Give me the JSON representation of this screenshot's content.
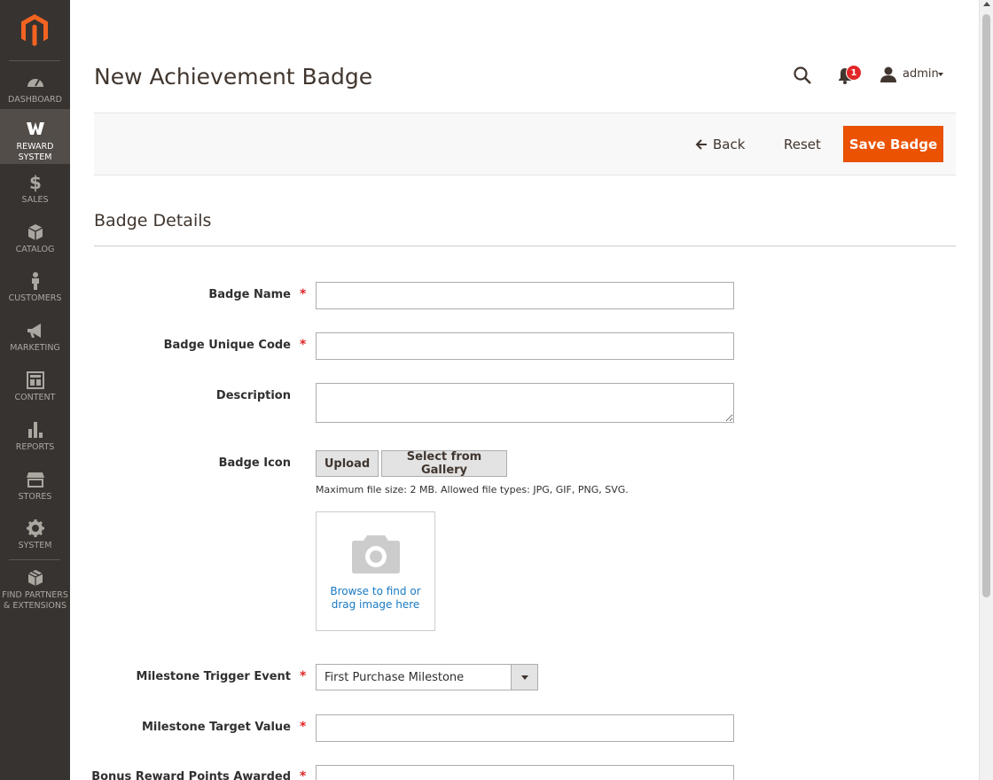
{
  "sidebar": {
    "items": [
      {
        "label": "DASHBOARD",
        "icon": "dashboard-icon"
      },
      {
        "label": "REWARD",
        "label2": "SYSTEM",
        "icon": "reward-w-icon"
      },
      {
        "label": "SALES",
        "icon": "dollar-icon"
      },
      {
        "label": "CATALOG",
        "icon": "box-icon"
      },
      {
        "label": "CUSTOMERS",
        "icon": "person-icon"
      },
      {
        "label": "MARKETING",
        "icon": "megaphone-icon"
      },
      {
        "label": "CONTENT",
        "icon": "content-layout-icon"
      },
      {
        "label": "REPORTS",
        "icon": "bar-chart-icon"
      },
      {
        "label": "STORES",
        "icon": "store-icon"
      },
      {
        "label": "SYSTEM",
        "icon": "gear-icon"
      },
      {
        "label": "FIND PARTNERS",
        "label2": "& EXTENSIONS",
        "icon": "extensions-box-icon"
      }
    ]
  },
  "header": {
    "title": "New Achievement Badge",
    "notification_count": "1",
    "username": "admin"
  },
  "actions": {
    "back": "Back",
    "reset": "Reset",
    "save": "Save Badge"
  },
  "section": {
    "title": "Badge Details"
  },
  "form": {
    "badge_name": {
      "label": "Badge Name",
      "value": ""
    },
    "badge_code": {
      "label": "Badge Unique Code",
      "value": ""
    },
    "description": {
      "label": "Description",
      "value": ""
    },
    "badge_icon": {
      "label": "Badge Icon",
      "upload": "Upload",
      "gallery": "Select from Gallery",
      "note": "Maximum file size: 2 MB. Allowed file types: JPG, GIF, PNG, SVG.",
      "drop_line1": "Browse to find or",
      "drop_line2": "drag image here"
    },
    "trigger_event": {
      "label": "Milestone Trigger Event",
      "value": "First Purchase Milestone"
    },
    "target_value": {
      "label": "Milestone Target Value",
      "value": ""
    },
    "bonus_points": {
      "label": "Bonus Reward Points Awarded",
      "value": ""
    }
  },
  "colors": {
    "sidebar_bg": "#373330",
    "accent": "#eb5202",
    "link": "#1979c3",
    "required": "#e22626"
  }
}
